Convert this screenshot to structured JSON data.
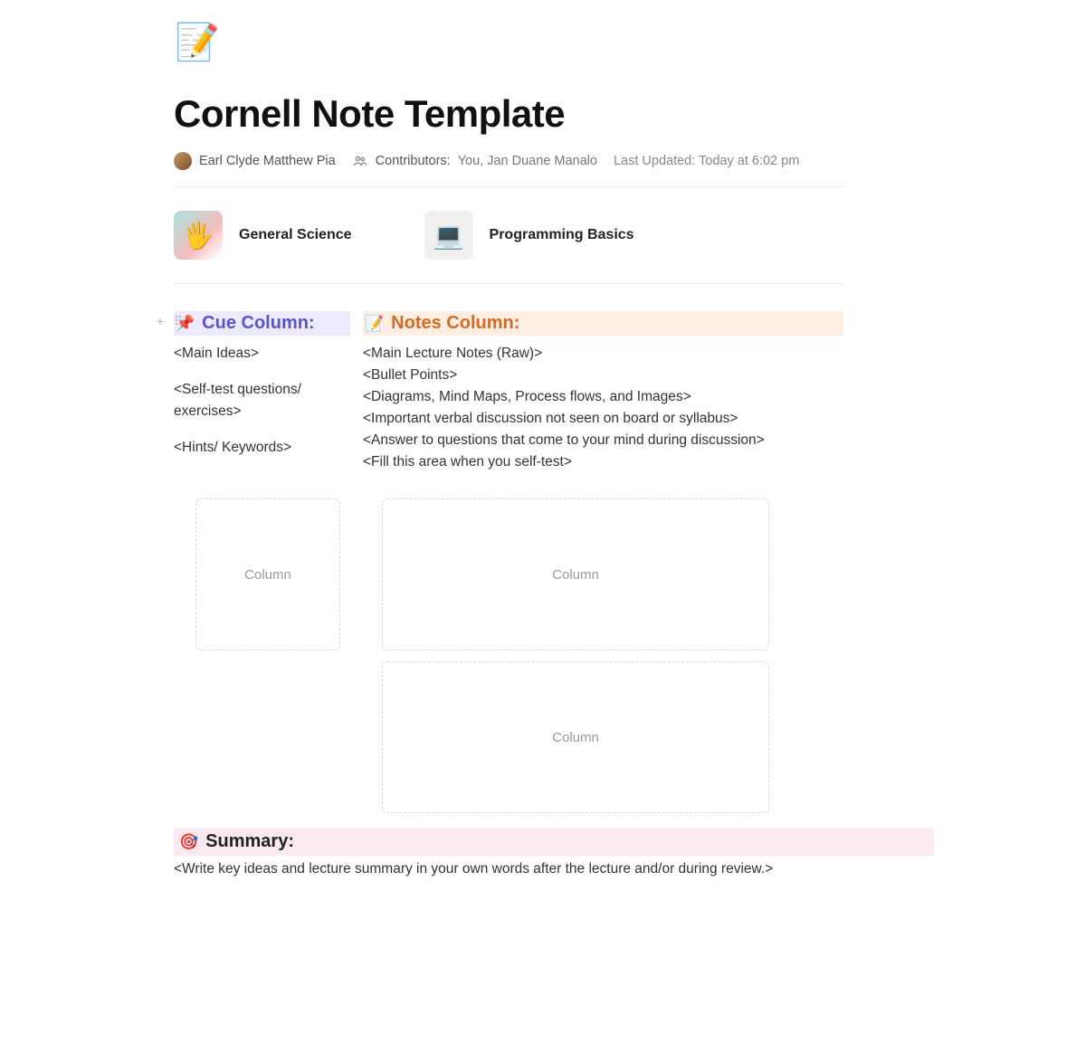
{
  "icon_emoji": "📝",
  "title": "Cornell Note Template",
  "meta": {
    "author": "Earl Clyde Matthew Pia",
    "contributors_label": "Contributors:",
    "contributors": "You, Jan Duane Manalo",
    "updated_label": "Last Updated:",
    "updated_value": "Today at 6:02 pm"
  },
  "cards": {
    "science": {
      "label": "General Science",
      "emoji": "🖐️"
    },
    "programming": {
      "label": "Programming Basics",
      "emoji": "💻"
    }
  },
  "columns": {
    "cue": {
      "heading": "Cue Column:",
      "lines": {
        "l1": "<Main Ideas>",
        "l2": "<Self-test questions/ exercises>",
        "l3": "<Hints/ Keywords>"
      }
    },
    "notes": {
      "heading": "Notes Column:",
      "lines": {
        "l1": "<Main Lecture Notes (Raw)>",
        "l2": "<Bullet Points>",
        "l3": "<Diagrams, Mind Maps, Process flows, and Images>",
        "l4": "<Important verbal discussion not seen on board or syllabus>",
        "l5": "<Answer to questions that come to your mind during discussion>",
        "l6": "<Fill this area when you self-test>"
      }
    }
  },
  "placeholder_label": "Column",
  "summary": {
    "heading": "Summary:",
    "body": "<Write key ideas and lecture summary in your own words after the lecture and/or during review.>"
  }
}
